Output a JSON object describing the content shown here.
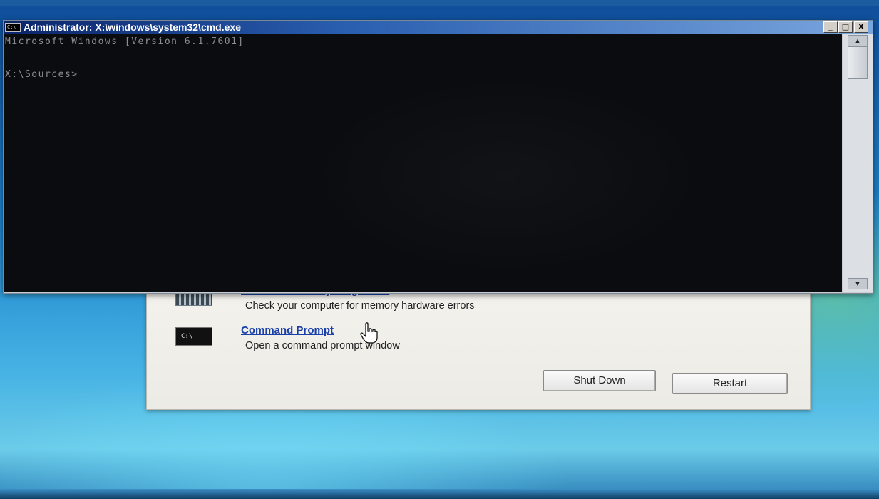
{
  "cmd_window": {
    "title": "Administrator: X:\\windows\\system32\\cmd.exe",
    "icon_text": "C:\\",
    "minimize_symbol": "_",
    "maximize_symbol": "□",
    "close_symbol": "X",
    "console_lines": [
      "Microsoft Windows [Version 6.1.7601]",
      "X:\\Sources>"
    ]
  },
  "recovery_options": {
    "tools": [
      {
        "title": "Windows Memory Diagnostic",
        "description": "Check your computer for memory hardware errors",
        "icon": "memory-chip-icon"
      },
      {
        "title": "Command Prompt",
        "description": "Open a command prompt window",
        "icon": "command-prompt-icon",
        "icon_text": "C:\\_"
      }
    ],
    "shutdown_label": "Shut Down",
    "restart_label": "Restart"
  },
  "cursor": "hand-pointer-icon"
}
